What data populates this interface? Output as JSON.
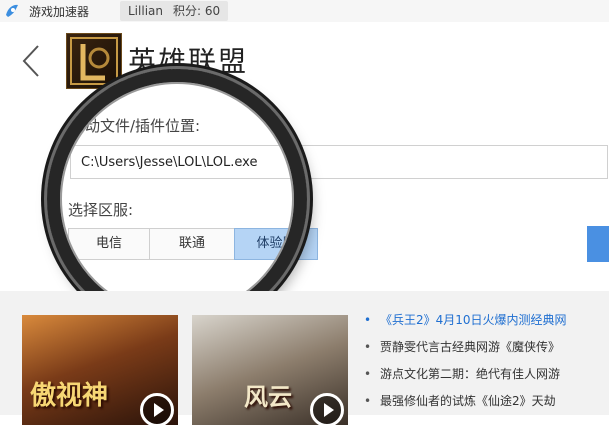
{
  "topbar": {
    "app_title": "游戏加速器",
    "user_name": "Lillian",
    "points_label": "积分:",
    "points_value": "60"
  },
  "header": {
    "back_icon": "chevron-left-icon",
    "game_name": "英雄联盟"
  },
  "form": {
    "path_label": "启动文件/插件位置:",
    "path_value": "C:\\Users\\Jesse\\LOL\\LOL.exe",
    "server_label": "选择区服:",
    "servers": [
      "电信",
      "联通",
      "体验服"
    ],
    "selected_server": "体验服"
  },
  "news": {
    "items": [
      "《兵王2》4月10日火爆内测经典网",
      "贾静雯代言古经典网游《魔侠传》",
      "游点文化第二期：绝代有佳人网游",
      "最强修仙者的试炼《仙途2》天劫"
    ],
    "thumbs": [
      {
        "title": "傲视神"
      },
      {
        "title": "风云"
      }
    ]
  },
  "colors": {
    "accent": "#4a90e2",
    "selected_segment": "#b5d4f5",
    "news_highlight": "#1f6fd1"
  }
}
